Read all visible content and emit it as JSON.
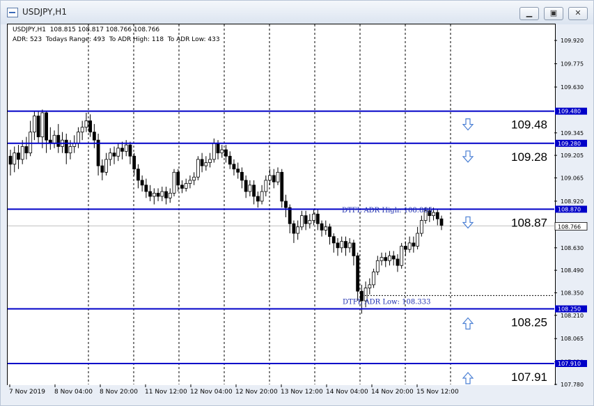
{
  "window": {
    "title": "USDJPY,H1",
    "minimize_label": "▁",
    "restore_label": "▣",
    "close_label": "✕"
  },
  "header": {
    "line1": "USDJPY,H1  108.815 108.817 108.766 108.766",
    "line2": "ADR: 523  Todays Range: 493  To ADR High: 118  To ADR Low: 433"
  },
  "colors": {
    "level_line": "#0000c8",
    "arrow": "#4a7fd4",
    "bull": "#ffffff",
    "bear": "#000000"
  },
  "chart_data": {
    "type": "candlestick",
    "symbol": "USDJPY",
    "timeframe": "H1",
    "ylim": [
      107.78,
      110.02
    ],
    "y_ticks": [
      109.92,
      109.775,
      109.63,
      109.345,
      109.205,
      109.065,
      108.92,
      108.63,
      108.49,
      108.35,
      108.21,
      108.065,
      107.92,
      107.78
    ],
    "x_ticks": [
      "7 Nov 2019",
      "8 Nov 04:00",
      "8 Nov 20:00",
      "11 Nov 12:00",
      "12 Nov 04:00",
      "12 Nov 20:00",
      "13 Nov 12:00",
      "14 Nov 04:00",
      "14 Nov 20:00",
      "15 Nov 12:00"
    ],
    "current_price": 108.766,
    "levels": [
      {
        "price": 109.48,
        "axis_label": "109.480",
        "text": "109.48",
        "arrow": "down"
      },
      {
        "price": 109.28,
        "axis_label": "109.280",
        "text": "109.28",
        "arrow": "down"
      },
      {
        "price": 108.87,
        "axis_label": "108.870",
        "text": "108.87",
        "arrow": "down"
      },
      {
        "price": 108.25,
        "axis_label": "108.250",
        "text": "108.25",
        "arrow": "up"
      },
      {
        "price": 107.91,
        "axis_label": "107.910",
        "text": "107.91",
        "arrow": "up"
      }
    ],
    "annotations": [
      {
        "text": "DTFL ADR High: 108.885",
        "price": 108.885
      },
      {
        "text": "DTFL ADR Low: 108.333",
        "price": 108.333
      }
    ],
    "candles": [
      [
        109.2,
        109.15,
        109.24,
        109.08
      ],
      [
        109.15,
        109.22,
        109.26,
        109.1
      ],
      [
        109.22,
        109.18,
        109.27,
        109.12
      ],
      [
        109.18,
        109.26,
        109.3,
        109.15
      ],
      [
        109.26,
        109.22,
        109.32,
        109.18
      ],
      [
        109.22,
        109.35,
        109.42,
        109.2
      ],
      [
        109.35,
        109.45,
        109.48,
        109.3
      ],
      [
        109.45,
        109.32,
        109.48,
        109.28
      ],
      [
        109.32,
        109.47,
        109.49,
        109.25
      ],
      [
        109.47,
        109.3,
        109.48,
        109.22
      ],
      [
        109.3,
        109.28,
        109.38,
        109.24
      ],
      [
        109.28,
        109.33,
        109.36,
        109.25
      ],
      [
        109.33,
        109.26,
        109.4,
        109.22
      ],
      [
        109.26,
        109.3,
        109.35,
        109.22
      ],
      [
        109.3,
        109.22,
        109.34,
        109.15
      ],
      [
        109.22,
        109.26,
        109.3,
        109.18
      ],
      [
        109.26,
        109.28,
        109.33,
        109.22
      ],
      [
        109.28,
        109.35,
        109.38,
        109.25
      ],
      [
        109.35,
        109.38,
        109.42,
        109.3
      ],
      [
        109.38,
        109.42,
        109.47,
        109.35
      ],
      [
        109.42,
        109.35,
        109.46,
        109.32
      ],
      [
        109.35,
        109.3,
        109.4,
        109.25
      ],
      [
        109.3,
        109.14,
        109.34,
        109.08
      ],
      [
        109.14,
        109.1,
        109.18,
        109.05
      ],
      [
        109.1,
        109.18,
        109.22,
        109.08
      ],
      [
        109.18,
        109.22,
        109.25,
        109.14
      ],
      [
        109.22,
        109.2,
        109.26,
        109.15
      ],
      [
        109.2,
        109.25,
        109.28,
        109.17
      ],
      [
        109.25,
        109.23,
        109.29,
        109.18
      ],
      [
        109.23,
        109.27,
        109.3,
        109.2
      ],
      [
        109.27,
        109.2,
        109.29,
        109.15
      ],
      [
        109.2,
        109.12,
        109.22,
        109.08
      ],
      [
        109.12,
        109.05,
        109.15,
        109.0
      ],
      [
        109.05,
        109.02,
        109.08,
        108.98
      ],
      [
        109.02,
        108.98,
        109.06,
        108.94
      ],
      [
        108.98,
        108.95,
        109.02,
        108.92
      ],
      [
        108.95,
        108.97,
        109.0,
        108.9
      ],
      [
        108.97,
        108.95,
        109.0,
        108.92
      ],
      [
        108.95,
        108.98,
        109.01,
        108.92
      ],
      [
        108.98,
        108.94,
        109.01,
        108.9
      ],
      [
        108.94,
        108.97,
        109.0,
        108.91
      ],
      [
        108.97,
        109.1,
        109.12,
        108.95
      ],
      [
        109.1,
        109.02,
        109.12,
        108.98
      ],
      [
        109.02,
        109.0,
        109.05,
        108.97
      ],
      [
        109.0,
        109.03,
        109.06,
        108.98
      ],
      [
        109.03,
        109.05,
        109.08,
        109.0
      ],
      [
        109.05,
        109.07,
        109.1,
        109.02
      ],
      [
        109.07,
        109.18,
        109.2,
        109.05
      ],
      [
        109.18,
        109.14,
        109.22,
        109.1
      ],
      [
        109.14,
        109.16,
        109.2,
        109.11
      ],
      [
        109.16,
        109.18,
        109.22,
        109.13
      ],
      [
        109.18,
        109.28,
        109.31,
        109.16
      ],
      [
        109.28,
        109.22,
        109.3,
        109.18
      ],
      [
        109.22,
        109.24,
        109.27,
        109.19
      ],
      [
        109.24,
        109.2,
        109.27,
        109.16
      ],
      [
        109.2,
        109.15,
        109.23,
        109.12
      ],
      [
        109.15,
        109.12,
        109.18,
        109.08
      ],
      [
        109.12,
        109.1,
        109.16,
        109.06
      ],
      [
        109.1,
        109.05,
        109.13,
        109.0
      ],
      [
        109.05,
        108.98,
        109.08,
        108.94
      ],
      [
        108.98,
        109.02,
        109.05,
        108.95
      ],
      [
        109.02,
        108.95,
        109.05,
        108.9
      ],
      [
        108.95,
        108.92,
        108.98,
        108.88
      ],
      [
        108.92,
        108.98,
        109.02,
        108.9
      ],
      [
        108.98,
        109.05,
        109.08,
        108.95
      ],
      [
        109.05,
        109.08,
        109.12,
        109.02
      ],
      [
        109.08,
        109.04,
        109.12,
        109.0
      ],
      [
        109.04,
        109.1,
        109.13,
        109.02
      ],
      [
        109.1,
        108.92,
        109.12,
        108.88
      ],
      [
        108.92,
        108.88,
        108.96,
        108.82
      ],
      [
        108.88,
        108.78,
        108.9,
        108.72
      ],
      [
        108.78,
        108.72,
        108.8,
        108.66
      ],
      [
        108.72,
        108.76,
        108.8,
        108.68
      ],
      [
        108.76,
        108.83,
        108.86,
        108.74
      ],
      [
        108.83,
        108.78,
        108.86,
        108.74
      ],
      [
        108.78,
        108.8,
        108.84,
        108.75
      ],
      [
        108.8,
        108.84,
        108.87,
        108.77
      ],
      [
        108.84,
        108.78,
        108.87,
        108.74
      ],
      [
        108.78,
        108.74,
        108.8,
        108.7
      ],
      [
        108.74,
        108.76,
        108.8,
        108.71
      ],
      [
        108.76,
        108.7,
        108.78,
        108.65
      ],
      [
        108.7,
        108.66,
        108.72,
        108.6
      ],
      [
        108.66,
        108.63,
        108.69,
        108.58
      ],
      [
        108.63,
        108.67,
        108.7,
        108.6
      ],
      [
        108.67,
        108.63,
        108.7,
        108.58
      ],
      [
        108.63,
        108.66,
        108.69,
        108.6
      ],
      [
        108.66,
        108.58,
        108.68,
        108.52
      ],
      [
        108.58,
        108.36,
        108.6,
        108.3
      ],
      [
        108.36,
        108.3,
        108.4,
        108.22
      ],
      [
        108.3,
        108.38,
        108.42,
        108.26
      ],
      [
        108.38,
        108.4,
        108.44,
        108.34
      ],
      [
        108.4,
        108.48,
        108.5,
        108.38
      ],
      [
        108.48,
        108.55,
        108.58,
        108.46
      ],
      [
        108.55,
        108.57,
        108.6,
        108.52
      ],
      [
        108.57,
        108.55,
        108.6,
        108.51
      ],
      [
        108.55,
        108.58,
        108.61,
        108.52
      ],
      [
        108.58,
        108.56,
        108.61,
        108.52
      ],
      [
        108.56,
        108.52,
        108.59,
        108.48
      ],
      [
        108.52,
        108.64,
        108.66,
        108.5
      ],
      [
        108.64,
        108.62,
        108.67,
        108.58
      ],
      [
        108.62,
        108.66,
        108.7,
        108.6
      ],
      [
        108.66,
        108.64,
        108.7,
        108.6
      ],
      [
        108.64,
        108.72,
        108.76,
        108.62
      ],
      [
        108.72,
        108.8,
        108.83,
        108.7
      ],
      [
        108.8,
        108.86,
        108.88,
        108.78
      ],
      [
        108.86,
        108.83,
        108.88,
        108.79
      ],
      [
        108.83,
        108.85,
        108.88,
        108.8
      ],
      [
        108.85,
        108.81,
        108.87,
        108.77
      ],
      [
        108.81,
        108.77,
        108.83,
        108.74
      ]
    ]
  }
}
